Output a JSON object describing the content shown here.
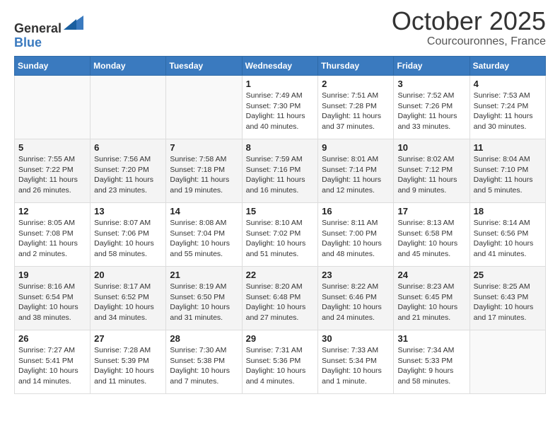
{
  "header": {
    "logo_general": "General",
    "logo_blue": "Blue",
    "month": "October 2025",
    "location": "Courcouronnes, France"
  },
  "weekdays": [
    "Sunday",
    "Monday",
    "Tuesday",
    "Wednesday",
    "Thursday",
    "Friday",
    "Saturday"
  ],
  "weeks": [
    [
      {
        "day": "",
        "info": ""
      },
      {
        "day": "",
        "info": ""
      },
      {
        "day": "",
        "info": ""
      },
      {
        "day": "1",
        "info": "Sunrise: 7:49 AM\nSunset: 7:30 PM\nDaylight: 11 hours\nand 40 minutes."
      },
      {
        "day": "2",
        "info": "Sunrise: 7:51 AM\nSunset: 7:28 PM\nDaylight: 11 hours\nand 37 minutes."
      },
      {
        "day": "3",
        "info": "Sunrise: 7:52 AM\nSunset: 7:26 PM\nDaylight: 11 hours\nand 33 minutes."
      },
      {
        "day": "4",
        "info": "Sunrise: 7:53 AM\nSunset: 7:24 PM\nDaylight: 11 hours\nand 30 minutes."
      }
    ],
    [
      {
        "day": "5",
        "info": "Sunrise: 7:55 AM\nSunset: 7:22 PM\nDaylight: 11 hours\nand 26 minutes."
      },
      {
        "day": "6",
        "info": "Sunrise: 7:56 AM\nSunset: 7:20 PM\nDaylight: 11 hours\nand 23 minutes."
      },
      {
        "day": "7",
        "info": "Sunrise: 7:58 AM\nSunset: 7:18 PM\nDaylight: 11 hours\nand 19 minutes."
      },
      {
        "day": "8",
        "info": "Sunrise: 7:59 AM\nSunset: 7:16 PM\nDaylight: 11 hours\nand 16 minutes."
      },
      {
        "day": "9",
        "info": "Sunrise: 8:01 AM\nSunset: 7:14 PM\nDaylight: 11 hours\nand 12 minutes."
      },
      {
        "day": "10",
        "info": "Sunrise: 8:02 AM\nSunset: 7:12 PM\nDaylight: 11 hours\nand 9 minutes."
      },
      {
        "day": "11",
        "info": "Sunrise: 8:04 AM\nSunset: 7:10 PM\nDaylight: 11 hours\nand 5 minutes."
      }
    ],
    [
      {
        "day": "12",
        "info": "Sunrise: 8:05 AM\nSunset: 7:08 PM\nDaylight: 11 hours\nand 2 minutes."
      },
      {
        "day": "13",
        "info": "Sunrise: 8:07 AM\nSunset: 7:06 PM\nDaylight: 10 hours\nand 58 minutes."
      },
      {
        "day": "14",
        "info": "Sunrise: 8:08 AM\nSunset: 7:04 PM\nDaylight: 10 hours\nand 55 minutes."
      },
      {
        "day": "15",
        "info": "Sunrise: 8:10 AM\nSunset: 7:02 PM\nDaylight: 10 hours\nand 51 minutes."
      },
      {
        "day": "16",
        "info": "Sunrise: 8:11 AM\nSunset: 7:00 PM\nDaylight: 10 hours\nand 48 minutes."
      },
      {
        "day": "17",
        "info": "Sunrise: 8:13 AM\nSunset: 6:58 PM\nDaylight: 10 hours\nand 45 minutes."
      },
      {
        "day": "18",
        "info": "Sunrise: 8:14 AM\nSunset: 6:56 PM\nDaylight: 10 hours\nand 41 minutes."
      }
    ],
    [
      {
        "day": "19",
        "info": "Sunrise: 8:16 AM\nSunset: 6:54 PM\nDaylight: 10 hours\nand 38 minutes."
      },
      {
        "day": "20",
        "info": "Sunrise: 8:17 AM\nSunset: 6:52 PM\nDaylight: 10 hours\nand 34 minutes."
      },
      {
        "day": "21",
        "info": "Sunrise: 8:19 AM\nSunset: 6:50 PM\nDaylight: 10 hours\nand 31 minutes."
      },
      {
        "day": "22",
        "info": "Sunrise: 8:20 AM\nSunset: 6:48 PM\nDaylight: 10 hours\nand 27 minutes."
      },
      {
        "day": "23",
        "info": "Sunrise: 8:22 AM\nSunset: 6:46 PM\nDaylight: 10 hours\nand 24 minutes."
      },
      {
        "day": "24",
        "info": "Sunrise: 8:23 AM\nSunset: 6:45 PM\nDaylight: 10 hours\nand 21 minutes."
      },
      {
        "day": "25",
        "info": "Sunrise: 8:25 AM\nSunset: 6:43 PM\nDaylight: 10 hours\nand 17 minutes."
      }
    ],
    [
      {
        "day": "26",
        "info": "Sunrise: 7:27 AM\nSunset: 5:41 PM\nDaylight: 10 hours\nand 14 minutes."
      },
      {
        "day": "27",
        "info": "Sunrise: 7:28 AM\nSunset: 5:39 PM\nDaylight: 10 hours\nand 11 minutes."
      },
      {
        "day": "28",
        "info": "Sunrise: 7:30 AM\nSunset: 5:38 PM\nDaylight: 10 hours\nand 7 minutes."
      },
      {
        "day": "29",
        "info": "Sunrise: 7:31 AM\nSunset: 5:36 PM\nDaylight: 10 hours\nand 4 minutes."
      },
      {
        "day": "30",
        "info": "Sunrise: 7:33 AM\nSunset: 5:34 PM\nDaylight: 10 hours\nand 1 minute."
      },
      {
        "day": "31",
        "info": "Sunrise: 7:34 AM\nSunset: 5:33 PM\nDaylight: 9 hours\nand 58 minutes."
      },
      {
        "day": "",
        "info": ""
      }
    ]
  ]
}
